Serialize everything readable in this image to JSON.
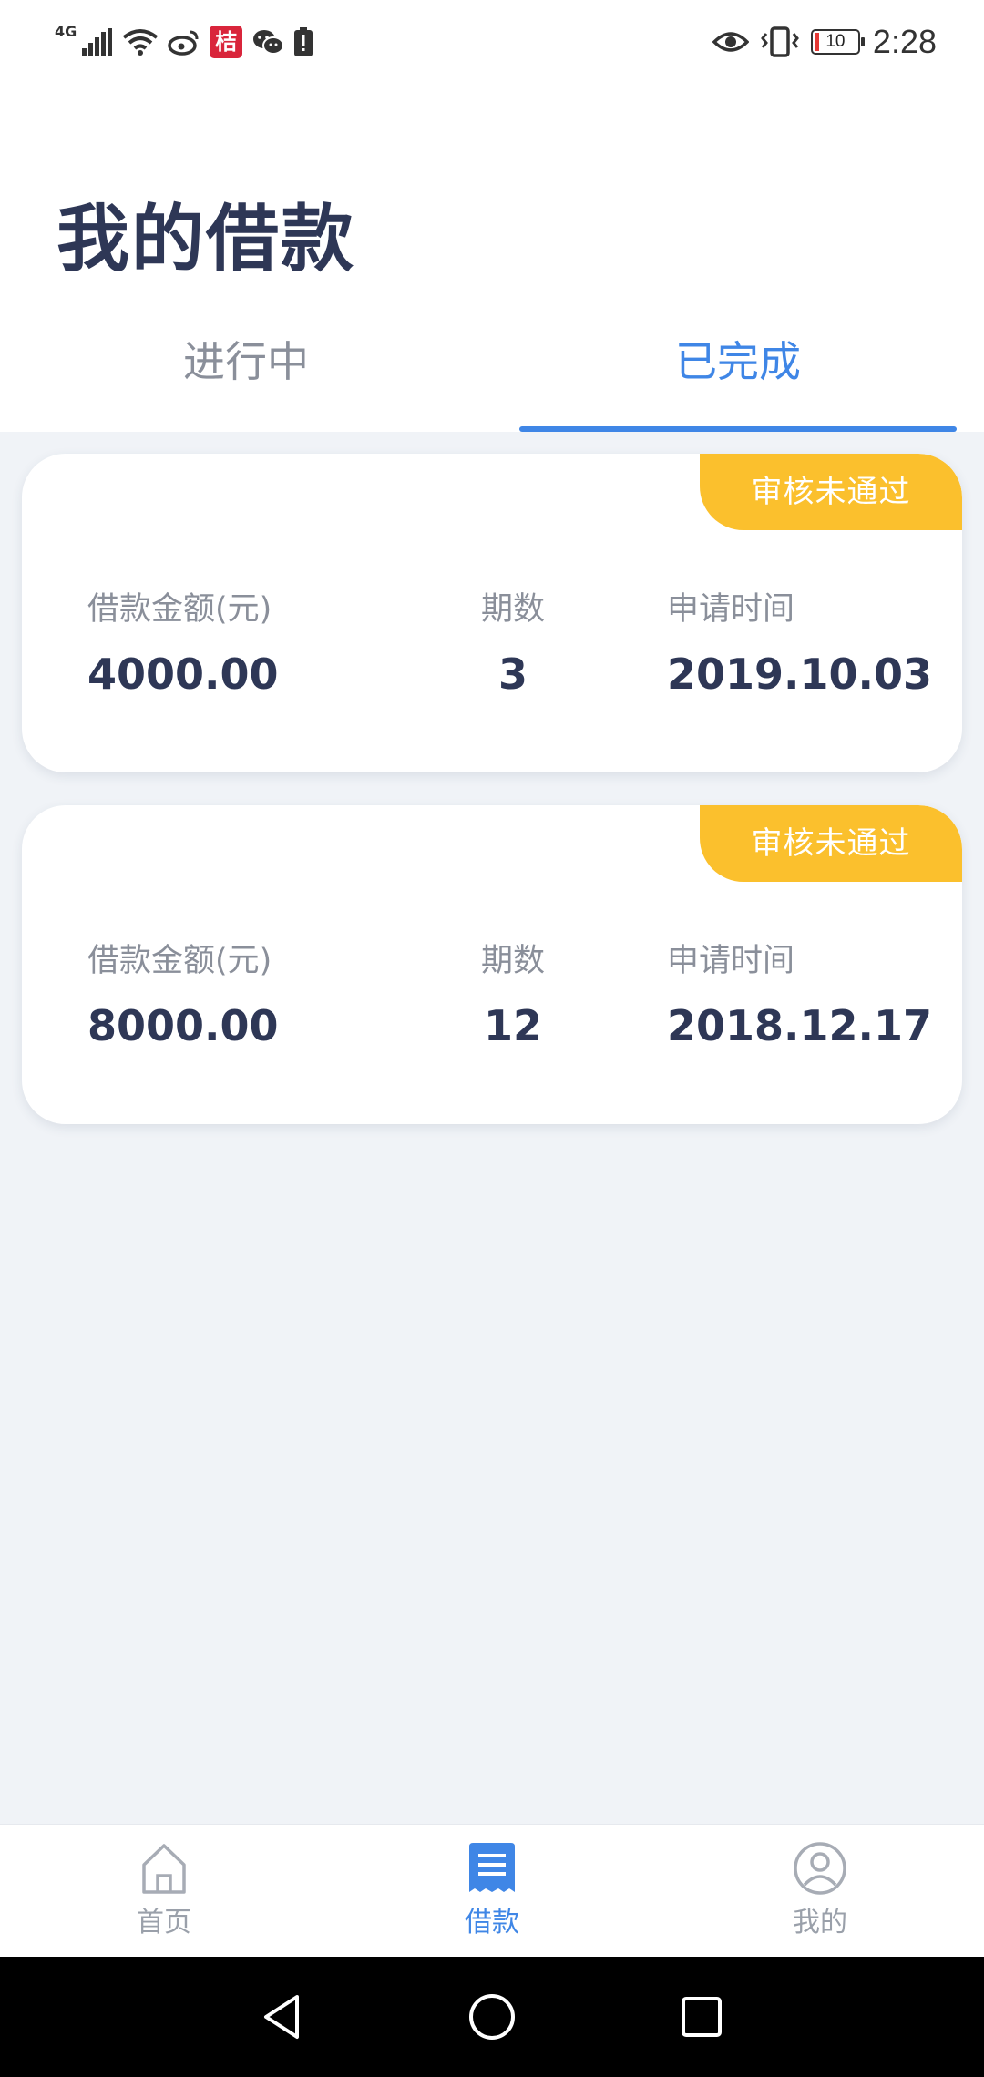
{
  "status_bar": {
    "network": "4G",
    "battery": "10",
    "time": "2:28",
    "icons": [
      "signal-icon",
      "wifi-icon",
      "weibo-icon",
      "app-badge-icon",
      "wechat-icon",
      "battery-alert-icon",
      "eye-icon",
      "vibrate-icon",
      "battery-icon"
    ]
  },
  "page_title": "我的借款",
  "tabs": [
    {
      "label": "进行中",
      "active": false
    },
    {
      "label": "已完成",
      "active": true
    }
  ],
  "loans": [
    {
      "status": "审核未通过",
      "amount_label": "借款金额(元)",
      "amount": "4000.00",
      "periods_label": "期数",
      "periods": "3",
      "date_label": "申请时间",
      "date": "2019.10.03"
    },
    {
      "status": "审核未通过",
      "amount_label": "借款金额(元)",
      "amount": "8000.00",
      "periods_label": "期数",
      "periods": "12",
      "date_label": "申请时间",
      "date": "2018.12.17"
    }
  ],
  "bottom_nav": [
    {
      "label": "首页",
      "icon": "home-icon",
      "active": false
    },
    {
      "label": "借款",
      "icon": "loan-icon",
      "active": true
    },
    {
      "label": "我的",
      "icon": "user-icon",
      "active": false
    }
  ],
  "colors": {
    "accent": "#3f86e6",
    "title": "#2e3756",
    "tag": "#fbc02d",
    "background": "#f0f3f7"
  }
}
